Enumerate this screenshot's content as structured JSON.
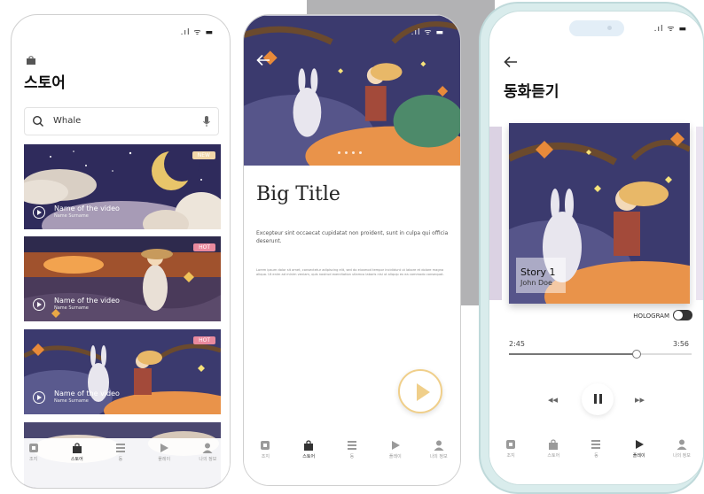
{
  "status": {
    "signal": ".ıl",
    "wifi": "ᯤ",
    "battery": "▬"
  },
  "store": {
    "title": "스토어",
    "search": {
      "value": "Whale"
    },
    "cards": [
      {
        "name": "Name of the video",
        "sub": "Name Surname",
        "badge": "NEW",
        "badge_color": "#f2d7a9"
      },
      {
        "name": "Name of the video",
        "sub": "Name Surname",
        "badge": "HOT",
        "badge_color": "#e98a9e"
      },
      {
        "name": "Name of the video",
        "sub": "Name Surname",
        "badge": "HOT",
        "badge_color": "#e98a9e"
      },
      {
        "name": "",
        "sub": "",
        "badge": "",
        "badge_color": ""
      }
    ]
  },
  "tabs": [
    {
      "label": "조지",
      "icon": "home-icon"
    },
    {
      "label": "스토어",
      "icon": "store-icon"
    },
    {
      "label": "동",
      "icon": "list-icon"
    },
    {
      "label": "플레이",
      "icon": "play-icon"
    },
    {
      "label": "나의 정보",
      "icon": "profile-icon"
    }
  ],
  "detail": {
    "title": "Big Title",
    "paragraph": "Excepteur sint occaecat cupidatat non proident, sunt in culpa qui officia deserunt.",
    "body": "Lorem ipsum dolor sit amet, consectetur adipiscing elit, sed do eiusmod tempor incididunt ut labore et dolore magna aliqua. Ut enim ad minim veniam, quis nostrud exercitation ullamco laboris nisi ut aliquip ex ea commodo consequat."
  },
  "player": {
    "title": "동화듣기",
    "story_title": "Story 1",
    "story_author": "John Doe",
    "hologram_label": "HOLOGRAM",
    "current_time": "2:45",
    "total_time": "3:56",
    "progress": 0.7
  },
  "colors": {
    "gold": "#f0cf8a",
    "night": "#3b3a6e",
    "leaf": "#e9934a"
  }
}
